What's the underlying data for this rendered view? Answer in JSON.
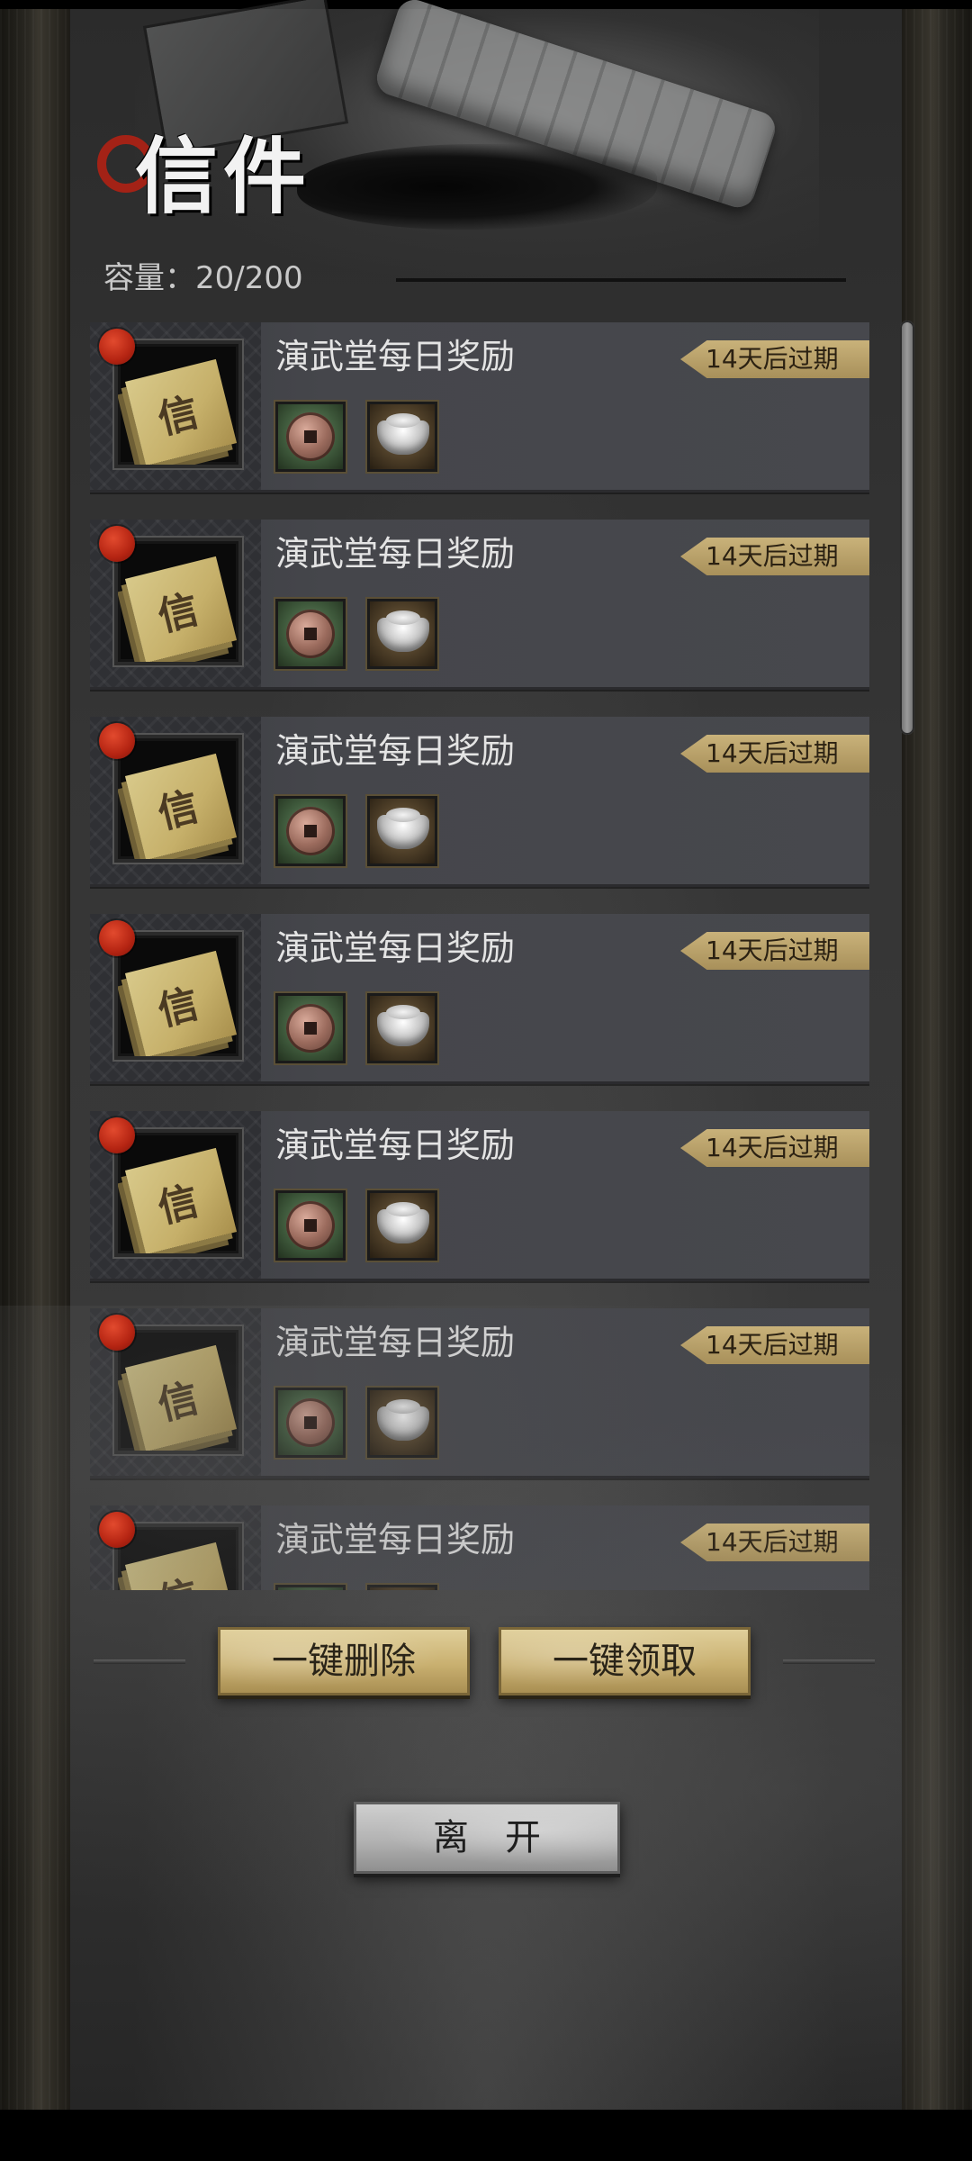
{
  "header": {
    "title": "信件",
    "capacity_label": "容量：",
    "capacity_value": "20/200"
  },
  "mails": [
    {
      "title": "演武堂每日奖励",
      "expire": "14天后过期",
      "unread": true,
      "icon_glyph": "信",
      "rewards": [
        "copper-coin-icon",
        "silver-ingot-icon"
      ]
    },
    {
      "title": "演武堂每日奖励",
      "expire": "14天后过期",
      "unread": true,
      "icon_glyph": "信",
      "rewards": [
        "copper-coin-icon",
        "silver-ingot-icon"
      ]
    },
    {
      "title": "演武堂每日奖励",
      "expire": "14天后过期",
      "unread": true,
      "icon_glyph": "信",
      "rewards": [
        "copper-coin-icon",
        "silver-ingot-icon"
      ]
    },
    {
      "title": "演武堂每日奖励",
      "expire": "14天后过期",
      "unread": true,
      "icon_glyph": "信",
      "rewards": [
        "copper-coin-icon",
        "silver-ingot-icon"
      ]
    },
    {
      "title": "演武堂每日奖励",
      "expire": "14天后过期",
      "unread": true,
      "icon_glyph": "信",
      "rewards": [
        "copper-coin-icon",
        "silver-ingot-icon"
      ]
    },
    {
      "title": "演武堂每日奖励",
      "expire": "14天后过期",
      "unread": true,
      "icon_glyph": "信",
      "rewards": [
        "copper-coin-icon",
        "silver-ingot-icon"
      ]
    },
    {
      "title": "演武堂每日奖励",
      "expire": "14天后过期",
      "unread": true,
      "icon_glyph": "信",
      "rewards": [
        "copper-coin-icon",
        "silver-ingot-icon"
      ]
    }
  ],
  "actions": {
    "delete_all": "一键删除",
    "claim_all": "一键领取",
    "leave": "离开"
  },
  "colors": {
    "unread_dot": "#b42412",
    "expire_tag": "#c9b27a",
    "gold_button": "#c9b070",
    "silver_button": "#b2b2b2"
  }
}
